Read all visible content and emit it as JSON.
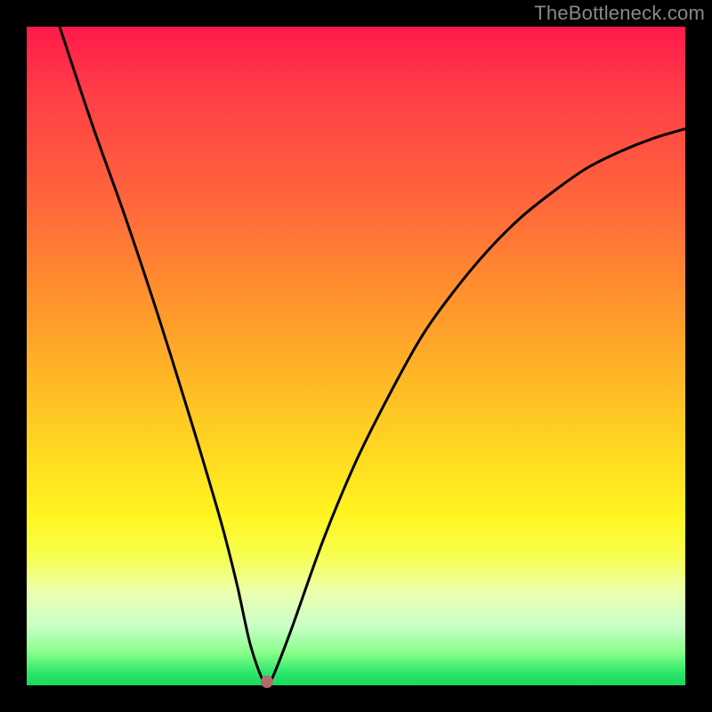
{
  "watermark": "TheBottleneck.com",
  "chart_data": {
    "type": "line",
    "title": "",
    "xlabel": "",
    "ylabel": "",
    "xlim": [
      0,
      100
    ],
    "ylim": [
      0,
      100
    ],
    "grid": false,
    "legend": false,
    "series": [
      {
        "name": "curve",
        "x": [
          5,
          10,
          15,
          20,
          25,
          28,
          30,
          32,
          34,
          36,
          37,
          40,
          45,
          50,
          55,
          60,
          65,
          70,
          75,
          80,
          85,
          90,
          95,
          100
        ],
        "y": [
          100,
          85,
          71,
          56,
          40,
          30,
          23,
          15,
          6,
          0.5,
          0.5,
          8,
          22,
          34,
          44,
          53,
          60,
          66,
          71,
          75,
          78.5,
          81,
          83,
          84.5
        ]
      }
    ],
    "marker": {
      "x": 36.5,
      "y": 0.6
    },
    "gradient_stops": [
      {
        "pos": 0,
        "color": "#ff1a4b"
      },
      {
        "pos": 10,
        "color": "#ff3d47"
      },
      {
        "pos": 28,
        "color": "#ff6a3a"
      },
      {
        "pos": 40,
        "color": "#ff8f2e"
      },
      {
        "pos": 52,
        "color": "#ffb327"
      },
      {
        "pos": 64,
        "color": "#ffd721"
      },
      {
        "pos": 74,
        "color": "#fff41f"
      },
      {
        "pos": 80,
        "color": "#f7ff4a"
      },
      {
        "pos": 86,
        "color": "#ecffb0"
      },
      {
        "pos": 91,
        "color": "#c8ffc8"
      },
      {
        "pos": 95,
        "color": "#8aff8a"
      },
      {
        "pos": 98,
        "color": "#2ee86a"
      },
      {
        "pos": 100,
        "color": "#18d85f"
      }
    ]
  }
}
